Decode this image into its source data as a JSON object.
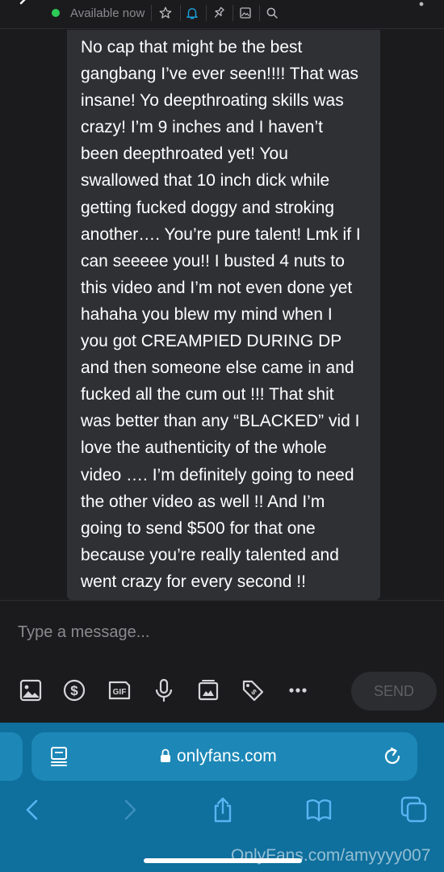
{
  "header": {
    "status": "Available now",
    "icons": [
      "back-icon",
      "star-icon",
      "bell-icon",
      "pin-icon",
      "gallery-icon",
      "search-icon",
      "more-icon"
    ],
    "status_color": "#2ccb57"
  },
  "message": {
    "text": "No cap that might be the best\ngangbang I’ve ever seen!!!! That was\ninsane! Yo deepthroating skills was\ncrazy! I’m 9 inches and I haven’t\nbeen deepthroated yet! You\nswallowed that 10 inch dick while\ngetting fucked doggy and stroking\nanother…. You’re pure talent! Lmk if I\ncan seeeee you!! I busted 4 nuts to\nthis video and I’m not even done yet\nhahaha you blew my mind when I\nyou got CREAMPIED DURING DP\nand then someone else came in and\nfucked all the cum out !!! That shit\nwas better than any “BLACKED” vid I\nlove the authenticity of the whole\nvideo …. I’m definitely going to need\nthe other video as well !! And I’m\ngoing to send $500 for that one\nbecause you’re really talented and\nwent crazy for every second !!"
  },
  "composer": {
    "placeholder": "Type a message...",
    "send_label": "SEND",
    "tools": [
      "image-icon",
      "dollar-icon",
      "gif-icon",
      "microphone-icon",
      "vault-icon",
      "price-tag-icon",
      "more-icon"
    ]
  },
  "browser": {
    "url": "onlyfans.com",
    "nav": [
      "back-arrow-icon",
      "forward-arrow-icon",
      "share-icon",
      "bookmarks-icon",
      "tabs-icon"
    ],
    "bar_color": "#0f6f9d"
  },
  "watermark": {
    "text": "OnlyFans.com/amyyyy007"
  }
}
